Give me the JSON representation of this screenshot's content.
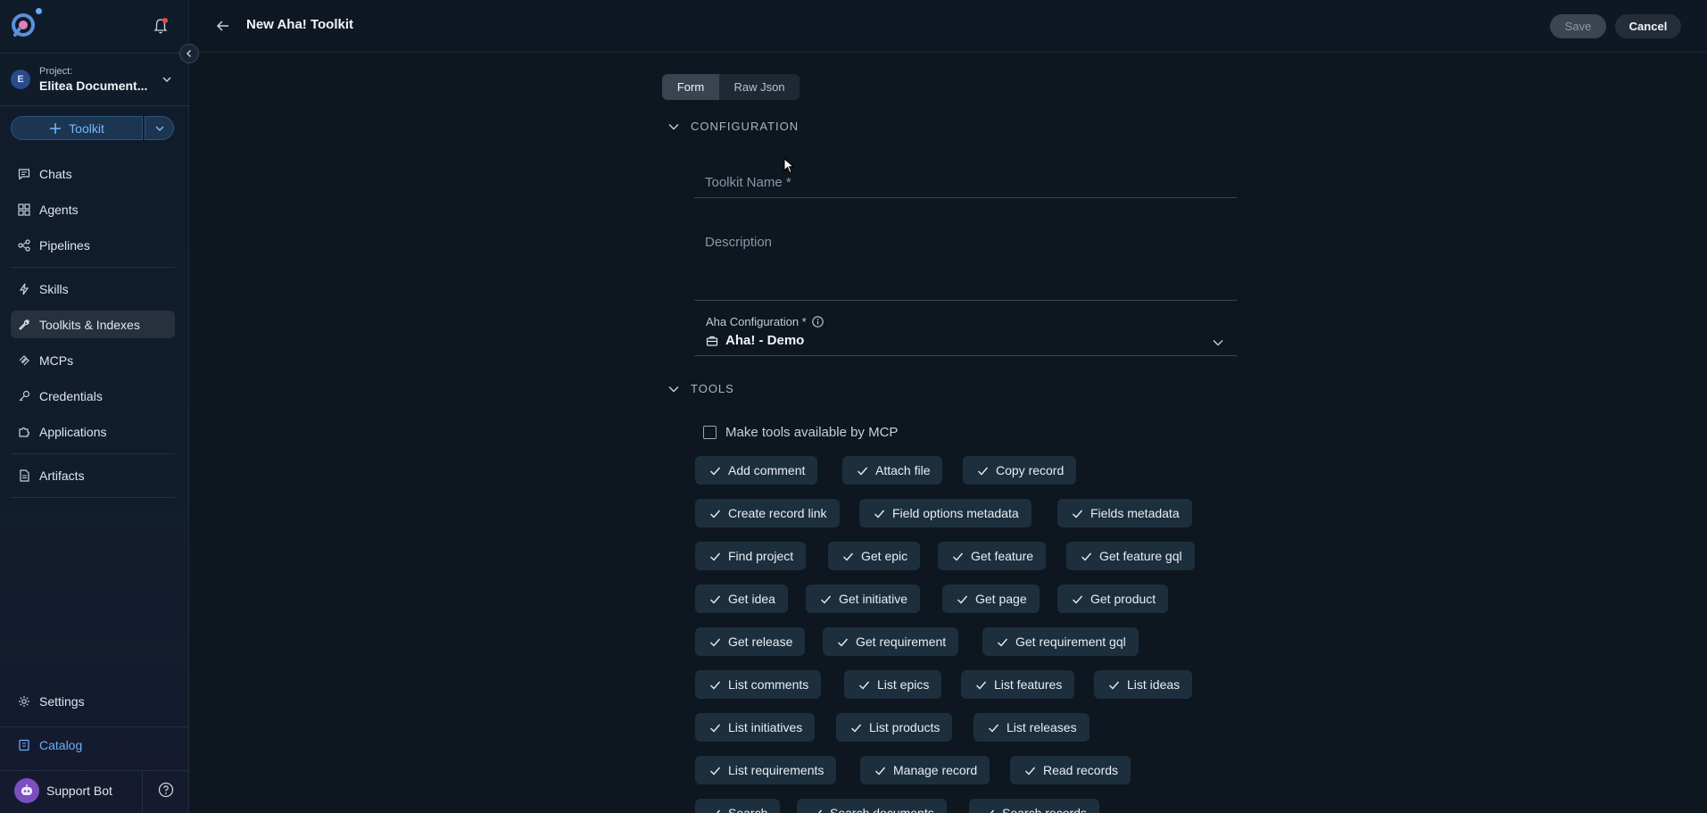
{
  "sidebar": {
    "project_label": "Project:",
    "project_name": "Elitea Document...",
    "project_initial": "E",
    "toolkit_button_label": "Toolkit",
    "nav": [
      {
        "label": "Chats",
        "icon": "chat-icon"
      },
      {
        "label": "Agents",
        "icon": "grid-icon"
      },
      {
        "label": "Pipelines",
        "icon": "pipeline-icon"
      },
      {
        "label": "Skills",
        "icon": "bolt-icon"
      },
      {
        "label": "Toolkits & Indexes",
        "icon": "wrench-icon",
        "active": true
      },
      {
        "label": "MCPs",
        "icon": "mcp-icon"
      },
      {
        "label": "Credentials",
        "icon": "key-icon"
      },
      {
        "label": "Applications",
        "icon": "puzzle-icon"
      },
      {
        "label": "Artifacts",
        "icon": "file-icon"
      },
      {
        "label": "Settings",
        "icon": "gear-icon"
      },
      {
        "label": "Catalog",
        "icon": "catalog-icon"
      }
    ],
    "support_label": "Support Bot"
  },
  "header": {
    "title": "New Aha! Toolkit",
    "save_label": "Save",
    "cancel_label": "Cancel"
  },
  "form": {
    "tabs": [
      "Form",
      "Raw Json"
    ],
    "configuration_heading": "CONFIGURATION",
    "toolkit_name_placeholder": "Toolkit Name *",
    "description_placeholder": "Description",
    "aha_config_label": "Aha Configuration *",
    "aha_config_value": "Aha! - Demo",
    "tools_heading": "TOOLS",
    "mcp_checkbox_label": "Make tools available by MCP",
    "tools": [
      "Add comment",
      "Attach file",
      "Copy record",
      "Create record link",
      "Field options metadata",
      "Fields metadata",
      "Find project",
      "Get epic",
      "Get feature",
      "Get feature gql",
      "Get idea",
      "Get initiative",
      "Get page",
      "Get product",
      "Get release",
      "Get requirement",
      "Get requirement gql",
      "List comments",
      "List epics",
      "List features",
      "List ideas",
      "List initiatives",
      "List products",
      "List releases",
      "List requirements",
      "Manage record",
      "Read records",
      "Search",
      "Search documents",
      "Search records"
    ]
  },
  "colors": {
    "accent": "#79b8ff",
    "background": "#0e1620",
    "chip": "#1d2f3d",
    "notification": "#e5484d"
  }
}
